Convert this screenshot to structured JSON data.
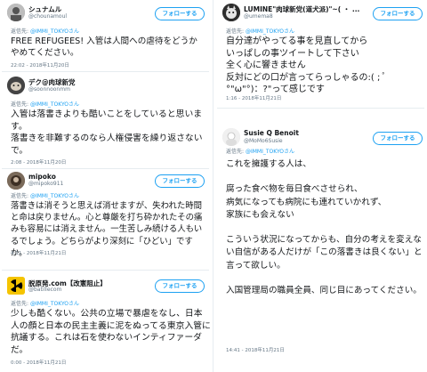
{
  "follow_label": "フォローする",
  "reply_prefix": "返信先:",
  "reply_target": "@IMMI_TOKYOさん",
  "tweets": [
    {
      "name": "シュナムル",
      "handle": "@chounamoul",
      "body": "FREE REFUGEES! 入管は人間への虐待をどうかやめてください。",
      "time": "22:02 - 2018年11月20日",
      "avatar_color": "#8d8d8d"
    },
    {
      "name": "デク@肉球新党",
      "handle": "@soonnoonmm",
      "body": "入管は落書きよりも酷いことをしていると思います。\n落書きを非難するのなら人権侵害を繰り返さないで。",
      "time": "2:08 - 2018年11月20日",
      "avatar_color": "#555555"
    },
    {
      "name": "mipoko",
      "handle": "@mipoko911",
      "body": "落書きは消そうと思えば消せますが、失われた時間と命は戻りません。心と尊厳を打ち砕かれたその痛みも容易には消えません。一生苦しみ続ける人もいるでしょう。どちらがより深刻に「ひどい」ですか。",
      "time": "4:11 - 2018年11月21日",
      "avatar_color": "#6b4f3a"
    },
    {
      "name": "脱原発.com【改憲阻止】",
      "handle": "@batillecom",
      "body": "少しも酷くない。公共の立場で暴虐をなし、日本人の顔と日本の民主主義に泥をぬってる東京入管に抗議する。これは石を使わないインティファーダだ。",
      "time": "0:00 - 2018年11月21日",
      "avatar_color": "#f5c400"
    },
    {
      "name": "LUMINE\"肉球新党(道犬派)\"~( ・ ...",
      "handle": "@umema8",
      "body": "自分達がやってる事を見直してから\nいっぱしの事ツイートして下さい\n全く心に響きません\n反対にどの口が言ってらっしゃるの:( ; ﾟ°\"ω\"°)：?\"って感じです",
      "time": "1:16 - 2018年11月21日",
      "avatar_color": "#3a3a3a"
    },
    {
      "name": "Susie Q Benoit",
      "handle": "@MoMo6Susie",
      "body": "これを擁護する人は、\n\n腐った食べ物を毎日食べさせられ、\n病気になっても病院にも連れていかれず、\n家族にも会えない\n\nこういう状況になってからも、自分の考えを変えない自信がある人だけが「この落書きは良くない」と言って欲しい。\n\n入国管理局の職員全員、同じ目にあってください。",
      "time": "14:41 - 2018年11月21日",
      "avatar_color": "#d9d9d9"
    }
  ]
}
